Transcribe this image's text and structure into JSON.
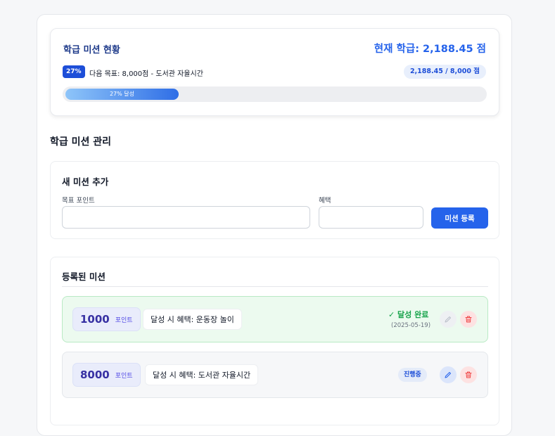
{
  "status": {
    "title": "학급 미션 현황",
    "current_score": "현재 학급: 2,188.45 점",
    "percent_badge": "27%",
    "next_goal": "다음 목표: 8,000점 - 도서관 자율시간",
    "score_pill": "2,188.45 / 8,000 점",
    "progress_label": "27% 달성",
    "progress_fraction": 0.27
  },
  "section_title": "학급 미션 관리",
  "add_form": {
    "title": "새 미션 추가",
    "points_label": "목표 포인트",
    "points_value": "",
    "benefit_label": "혜택",
    "benefit_value": "",
    "submit_label": "미션 등록"
  },
  "missions_section": {
    "title": "등록된 미션",
    "items": [
      {
        "points": "1000",
        "unit": "포인트",
        "benefit": "달성 시 혜택: 운동장 놀이",
        "status": "✓ 달성 완료",
        "date": "(2025-05-19)"
      },
      {
        "points": "8000",
        "unit": "포인트",
        "benefit": "달성 시 혜택: 도서관 자율시간",
        "status": "진행중"
      }
    ]
  },
  "colors": {
    "accent": "#2563eb",
    "done": "#16a34a",
    "danger": "#ef4444"
  },
  "icons": [
    "pencil-icon",
    "trash-icon",
    "check-icon"
  ]
}
